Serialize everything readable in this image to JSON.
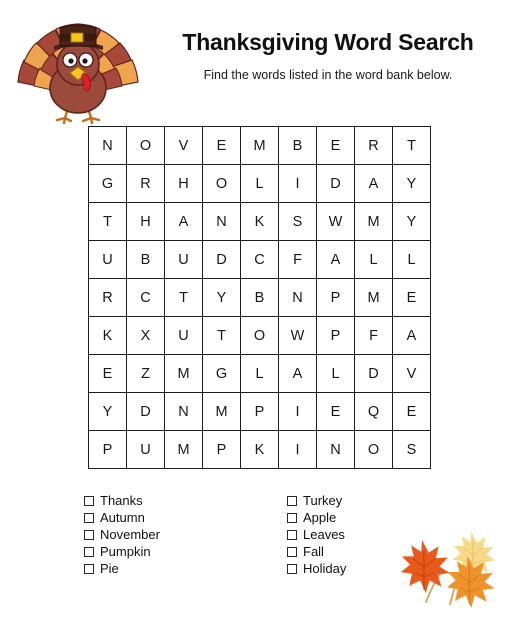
{
  "header": {
    "title": "Thanksgiving Word Search",
    "subtitle": "Find the words listed in the word bank below.",
    "turkey_icon": "turkey-illustration",
    "leaves_icon": "autumn-leaves-illustration"
  },
  "puzzle": {
    "rows": 9,
    "cols": 9,
    "grid": [
      [
        "N",
        "O",
        "V",
        "E",
        "M",
        "B",
        "E",
        "R",
        "T"
      ],
      [
        "G",
        "R",
        "H",
        "O",
        "L",
        "I",
        "D",
        "A",
        "Y"
      ],
      [
        "T",
        "H",
        "A",
        "N",
        "K",
        "S",
        "W",
        "M",
        "Y"
      ],
      [
        "U",
        "B",
        "U",
        "D",
        "C",
        "F",
        "A",
        "L",
        "L"
      ],
      [
        "R",
        "C",
        "T",
        "Y",
        "B",
        "N",
        "P",
        "M",
        "E"
      ],
      [
        "K",
        "X",
        "U",
        "T",
        "O",
        "W",
        "P",
        "F",
        "A"
      ],
      [
        "E",
        "Z",
        "M",
        "G",
        "L",
        "A",
        "L",
        "D",
        "V"
      ],
      [
        "Y",
        "D",
        "N",
        "M",
        "P",
        "I",
        "E",
        "Q",
        "E"
      ],
      [
        "P",
        "U",
        "M",
        "P",
        "K",
        "I",
        "N",
        "O",
        "S"
      ]
    ]
  },
  "word_bank": {
    "columns": [
      {
        "items": [
          {
            "label": "Thanks",
            "checked": false
          },
          {
            "label": "Autumn",
            "checked": false
          },
          {
            "label": "November",
            "checked": false
          },
          {
            "label": "Pumpkin",
            "checked": false
          },
          {
            "label": "Pie",
            "checked": false
          }
        ]
      },
      {
        "items": [
          {
            "label": "Turkey",
            "checked": false
          },
          {
            "label": "Apple",
            "checked": false
          },
          {
            "label": "Leaves",
            "checked": false
          },
          {
            "label": "Fall",
            "checked": false
          },
          {
            "label": "Holiday",
            "checked": false
          }
        ]
      }
    ]
  },
  "colors": {
    "page_background": "#ffffff",
    "text": "#111111",
    "grid_line": "#1c1c1c",
    "turkey_body": "#9c4a3c",
    "turkey_feather_dark": "#a8483a",
    "turkey_feather_light": "#f0a44e",
    "turkey_hat": "#4a2318",
    "turkey_beak": "#f5c518",
    "turkey_wattle": "#e02020",
    "turkey_legs": "#f08a2a",
    "leaf_red": "#e8591c",
    "leaf_orange": "#f0922c",
    "leaf_yellow": "#f7d98a",
    "leaf_stem": "#d9a86a"
  }
}
